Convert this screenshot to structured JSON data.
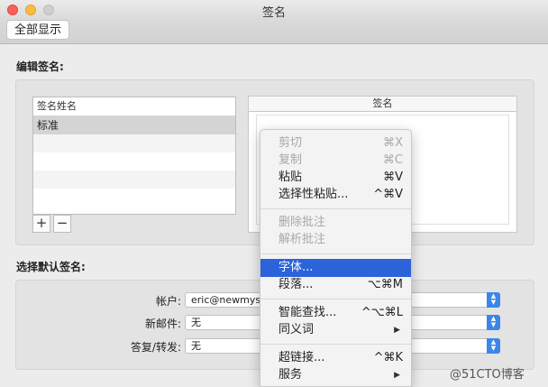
{
  "window": {
    "title": "签名"
  },
  "toolbar": {
    "show_all": "全部显示"
  },
  "edit_section": {
    "label": "编辑签名:",
    "list": {
      "header": "签名姓名",
      "items": [
        "标准"
      ]
    },
    "add_label": "+",
    "remove_label": "−",
    "signature_header": "签名"
  },
  "default_section": {
    "label": "选择默认签名:",
    "account_label": "帐户:",
    "account_value": "eric@newmys",
    "new_mail_label": "新邮件:",
    "new_mail_value": "无",
    "reply_label": "答复/转发:",
    "reply_value": "无"
  },
  "context_menu": {
    "cut": {
      "label": "剪切",
      "shortcut": "⌘X"
    },
    "copy": {
      "label": "复制",
      "shortcut": "⌘C"
    },
    "paste": {
      "label": "粘贴",
      "shortcut": "⌘V"
    },
    "paste_special": {
      "label": "选择性粘贴...",
      "shortcut": "^⌘V"
    },
    "delete_comment": {
      "label": "删除批注"
    },
    "resolve_comment": {
      "label": "解析批注"
    },
    "font": {
      "label": "字体..."
    },
    "paragraph": {
      "label": "段落...",
      "shortcut": "⌥⌘M"
    },
    "smart_lookup": {
      "label": "智能查找...",
      "shortcut": "^⌥⌘L"
    },
    "synonyms": {
      "label": "同义词"
    },
    "hyperlink": {
      "label": "超链接...",
      "shortcut": "^⌘K"
    },
    "services": {
      "label": "服务"
    }
  },
  "watermark": "@51CTO博客",
  "colors": {
    "menu_highlight": "#2b63d9",
    "select_arrow": "#3c86e8"
  }
}
